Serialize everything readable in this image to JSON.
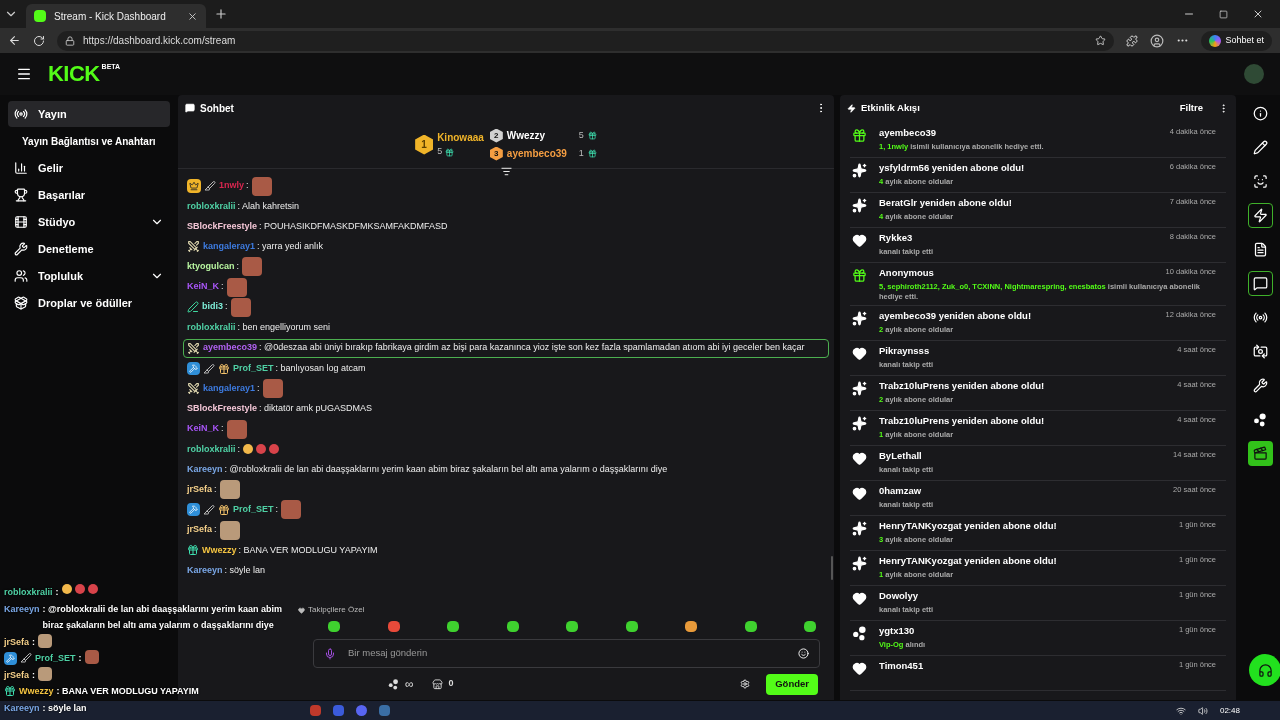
{
  "browser": {
    "tab_title": "Stream - Kick Dashboard",
    "url": "https://dashboard.kick.com/stream",
    "copilot_label": "Sohbet et"
  },
  "header": {
    "logo": "KICK",
    "logo_badge": "BETA"
  },
  "sidebar": {
    "items": [
      {
        "label": "Yayın",
        "kind": "broadcast",
        "selected": true,
        "expandable": false
      },
      {
        "label": "Yayın Bağlantısı ve Anahtarı",
        "kind": "sub",
        "selected": false,
        "expandable": false
      },
      {
        "label": "Gelir",
        "kind": "chart",
        "selected": false,
        "expandable": false
      },
      {
        "label": "Başarılar",
        "kind": "trophy",
        "selected": false,
        "expandable": false
      },
      {
        "label": "Stüdyo",
        "kind": "film",
        "selected": false,
        "expandable": true
      },
      {
        "label": "Denetleme",
        "kind": "wrench",
        "selected": false,
        "expandable": false
      },
      {
        "label": "Topluluk",
        "kind": "users",
        "selected": false,
        "expandable": true
      },
      {
        "label": "Droplar ve ödüller",
        "kind": "drops",
        "selected": false,
        "expandable": false
      }
    ]
  },
  "chat": {
    "title": "Sohbet",
    "leaderboard": [
      {
        "rank": "1",
        "name": "Kinowaaa",
        "count": "5"
      },
      {
        "rank": "2",
        "name": "Wwezzy",
        "count": "5"
      },
      {
        "rank": "3",
        "name": "ayembeco39",
        "count": "1"
      }
    ],
    "messages": [
      {
        "badges": [
          {
            "kind": "crown"
          },
          {
            "kind": "knife"
          }
        ],
        "user": "1nwly",
        "color": "#d8264f",
        "text": ":",
        "emotes": [
          {
            "kind": "face"
          }
        ],
        "highlighted": false
      },
      {
        "user": "robloxkralii",
        "color": "#4fd1a5",
        "text": ": Alah kahretsin",
        "highlighted": false
      },
      {
        "user": "SBlockFreestyle",
        "color": "#f3c6d6",
        "text": ": POUHASIKDFMASKDFMKSAMFAKDMFASD",
        "highlighted": false
      },
      {
        "badges": [
          {
            "kind": "swords"
          }
        ],
        "user": "kangaleray1",
        "color": "#3d7be0",
        "text": ": yarra yedi anlık",
        "highlighted": false
      },
      {
        "user": "ktyogulcan",
        "color": "#b8f5a0",
        "text": ":",
        "emotes": [
          {
            "kind": "face"
          }
        ],
        "highlighted": false
      },
      {
        "user": "KeiN_K",
        "color": "#a855f7",
        "text": ":",
        "emotes": [
          {
            "kind": "face"
          }
        ],
        "highlighted": false
      },
      {
        "badges": [
          {
            "kind": "pen"
          }
        ],
        "user": "bidi3",
        "color": "#7eeed8",
        "text": ":",
        "emotes": [
          {
            "kind": "face"
          }
        ],
        "highlighted": false
      },
      {
        "user": "robloxkralii",
        "color": "#4fd1a5",
        "text": ": ben engelliyorum seni",
        "highlighted": false
      },
      {
        "badges": [
          {
            "kind": "swords"
          }
        ],
        "user": "ayembeco39",
        "color": "#b062f0",
        "text": ": @0deszaa abi üniyi bırakıp fabrikaya girdim az bişi para kazanınca yioz işte son kez fazla spamlamadan atıom abi iyi geceler ben kaçar",
        "highlighted": true
      },
      {
        "badges": [
          {
            "kind": "hammer"
          },
          {
            "kind": "knife"
          },
          {
            "kind": "gift"
          }
        ],
        "user": "Prof_SET",
        "color": "#4fd1a5",
        "text": ": banlıyosan log atcam",
        "highlighted": false
      },
      {
        "badges": [
          {
            "kind": "swords"
          }
        ],
        "user": "kangaleray1",
        "color": "#3d7be0",
        "text": ":",
        "emotes": [
          {
            "kind": "face"
          }
        ],
        "highlighted": false
      },
      {
        "user": "SBlockFreestyle",
        "color": "#f3c6d6",
        "text": ": diktatör amk pUGASDMAS",
        "highlighted": false
      },
      {
        "user": "KeiN_K",
        "color": "#a855f7",
        "text": ":",
        "emotes": [
          {
            "kind": "face"
          }
        ],
        "highlighted": false
      },
      {
        "user": "robloxkralii",
        "color": "#4fd1a5",
        "text": ":",
        "emotes": [
          {
            "kind": "laugh"
          },
          {
            "kind": "angry"
          },
          {
            "kind": "angry"
          }
        ],
        "highlighted": false
      },
      {
        "user": "Kareeyn",
        "color": "#7aa7e6",
        "text": ": @robloxkralii de lan abi daaşşaklarını yerim kaan abim biraz şakaların bel altı ama yalarım o daşşaklarını diye",
        "highlighted": false
      },
      {
        "user": "jrSefa",
        "color": "#f5d08a",
        "text": ":",
        "emotes": [
          {
            "kind": "cat"
          }
        ],
        "highlighted": false
      },
      {
        "badges": [
          {
            "kind": "hammer"
          },
          {
            "kind": "knife"
          },
          {
            "kind": "gift"
          }
        ],
        "user": "Prof_SET",
        "color": "#4fd1a5",
        "text": ":",
        "emotes": [
          {
            "kind": "face"
          }
        ],
        "highlighted": false
      },
      {
        "user": "jrSefa",
        "color": "#f5d08a",
        "text": ":",
        "emotes": [
          {
            "kind": "cat"
          }
        ],
        "highlighted": false
      },
      {
        "badges": [
          {
            "kind": "sub"
          }
        ],
        "user": "Wwezzy",
        "color": "#f5c542",
        "text": ": BANA VER MODLUGU YAPAYIM",
        "highlighted": false
      },
      {
        "user": "Kareeyn",
        "color": "#7aa7e6",
        "text": ": söyle lan",
        "highlighted": false
      }
    ],
    "followers_only": "Takipçilere Özel",
    "input": {
      "placeholder": "Bir mesaj gönderin"
    },
    "points": "∞",
    "store_count": "0",
    "send_button": "Gönder"
  },
  "activity": {
    "title": "Etkinlik Akışı",
    "filter": "Filtre",
    "items": [
      {
        "kind": "gift",
        "title": "ayembeco39",
        "highlight": "1, 1nwly",
        "detail": " isimli kullanıcıya abonelik hediye etti.",
        "time": "4 dakika önce"
      },
      {
        "kind": "resub",
        "title": "ysfyldrm56 yeniden abone oldu!",
        "highlight": "4",
        "detail": " aylık abone oldular",
        "time": "6 dakika önce"
      },
      {
        "kind": "resub",
        "title": "BeratGlr yeniden abone oldu!",
        "highlight": "4",
        "detail": " aylık abone oldular",
        "time": "7 dakika önce"
      },
      {
        "kind": "follow",
        "title": "Rykke3",
        "detail": "kanalı takip etti",
        "time": "8 dakika önce"
      },
      {
        "kind": "gift",
        "title": "Anonymous",
        "highlight": "5, sephiroth2112, Zuk_o0, TCXINN, Nightmarespring, enesbatos",
        "detail": " isimli kullanıcıya abonelik hediye etti.",
        "time": "10 dakika önce"
      },
      {
        "kind": "resub",
        "title": "ayembeco39 yeniden abone oldu!",
        "highlight": "2",
        "detail": " aylık abone oldular",
        "time": "12 dakika önce"
      },
      {
        "kind": "follow",
        "title": "Pikraynsss",
        "detail": "kanalı takip etti",
        "time": "4 saat önce"
      },
      {
        "kind": "resub",
        "title": "Trabz10luPrens yeniden abone oldu!",
        "highlight": "2",
        "detail": " aylık abone oldular",
        "time": "4 saat önce"
      },
      {
        "kind": "resub",
        "title": "Trabz10luPrens yeniden abone oldu!",
        "highlight": "1",
        "detail": " aylık abone oldular",
        "time": "4 saat önce"
      },
      {
        "kind": "follow",
        "title": "ByLethall",
        "detail": "kanalı takip etti",
        "time": "14 saat önce"
      },
      {
        "kind": "follow",
        "title": "0hamzaw",
        "detail": "kanalı takip etti",
        "time": "20 saat önce"
      },
      {
        "kind": "resub",
        "title": "HenryTANKyozgat yeniden abone oldu!",
        "highlight": "3",
        "detail": " aylık abone oldular",
        "time": "1 gün önce"
      },
      {
        "kind": "resub",
        "title": "HenryTANKyozgat yeniden abone oldu!",
        "highlight": "1",
        "detail": " aylık abone oldular",
        "time": "1 gün önce"
      },
      {
        "kind": "follow",
        "title": "Dowolyy",
        "detail": "kanalı takip etti",
        "time": "1 gün önce"
      },
      {
        "kind": "reward",
        "title": "ygtx130",
        "highlight": "Vip-Og",
        "detail": " alındı",
        "time": "1 gün önce"
      },
      {
        "kind": "follow",
        "title": "Timon451",
        "time": "1 gün önce"
      }
    ]
  },
  "rail": [
    {
      "kind": "info",
      "selected": false,
      "highlighted": false
    },
    {
      "kind": "edit",
      "selected": false,
      "highlighted": false
    },
    {
      "kind": "capture",
      "selected": false,
      "highlighted": false
    },
    {
      "kind": "activity",
      "selected": true,
      "highlighted": false
    },
    {
      "kind": "notes",
      "selected": false,
      "highlighted": false
    },
    {
      "kind": "chat",
      "selected": true,
      "highlighted": false
    },
    {
      "kind": "broadcast",
      "selected": false,
      "highlighted": false
    },
    {
      "kind": "camera",
      "selected": false,
      "highlighted": false
    },
    {
      "kind": "moderation",
      "selected": false,
      "highlighted": false
    },
    {
      "kind": "drops",
      "selected": false,
      "highlighted": false
    },
    {
      "kind": "clips",
      "selected": false,
      "highlighted": true
    }
  ],
  "overlay": {
    "lines": [
      {
        "user": "robloxkralii",
        "color": "#4fd1a5",
        "text": ":",
        "emotes": [
          {
            "kind": "laugh"
          },
          {
            "kind": "angry"
          },
          {
            "kind": "angry"
          }
        ]
      },
      {
        "user": "Kareeyn",
        "color": "#7aa7e6",
        "text": ": @robloxkralii de lan abi daaşşaklarını yerim kaan abim biraz şakaların bel altı ama yalarım o daşşaklarını diye"
      },
      {
        "user": "jrSefa",
        "color": "#f5d08a",
        "text": ":",
        "emotes": [
          {
            "kind": "cat"
          }
        ]
      },
      {
        "badges": [
          {
            "kind": "hammer"
          },
          {
            "kind": "knife"
          }
        ],
        "user": "Prof_SET",
        "color": "#4fd1a5",
        "text": ":",
        "emotes": [
          {
            "kind": "face"
          }
        ]
      },
      {
        "user": "jrSefa",
        "color": "#f5d08a",
        "text": ":",
        "emotes": [
          {
            "kind": "cat"
          }
        ]
      },
      {
        "badges": [
          {
            "kind": "sub"
          }
        ],
        "user": "Wwezzy",
        "color": "#f5c542",
        "text": ": BANA VER MODLUGU YAPAYIM"
      },
      {
        "user": "Kareeyn",
        "color": "#7aa7e6",
        "text": ": söyle lan"
      }
    ]
  },
  "taskbar": {
    "clock": "02:48"
  }
}
